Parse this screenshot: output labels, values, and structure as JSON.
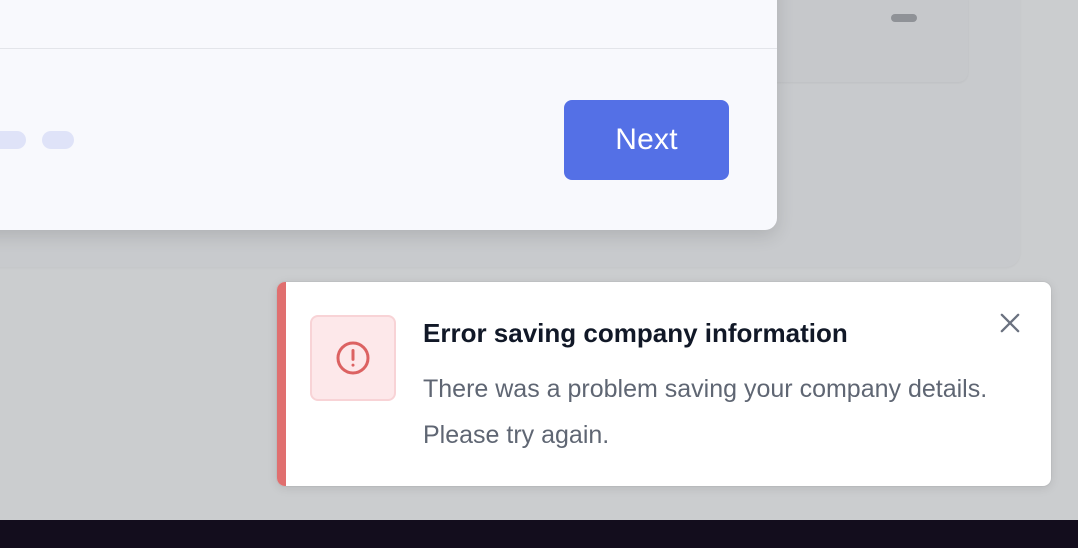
{
  "modal": {
    "next_button_label": "Next",
    "step_dots": [
      {
        "name": "step-indicator-1",
        "state": "inactive"
      },
      {
        "name": "step-indicator-2",
        "state": "inactive"
      }
    ]
  },
  "toast": {
    "title": "Error saving company information",
    "message": "There was a problem saving your company details. Please try again.",
    "status": "error",
    "icon": "alert-circle-icon",
    "close_icon": "close-icon"
  },
  "colors": {
    "primary_button": "#5470e6",
    "error_accent": "#e06f6f",
    "error_icon_bg": "#fde8ea",
    "error_icon": "#dc6262"
  }
}
